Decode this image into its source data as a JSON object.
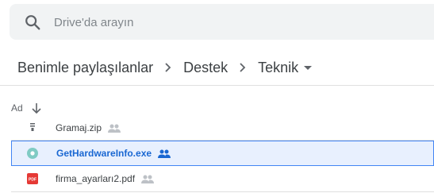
{
  "search": {
    "placeholder": "Drive'da arayın",
    "icon": "search-icon"
  },
  "breadcrumb": {
    "items": [
      "Benimle paylaşılanlar",
      "Destek",
      "Teknik"
    ]
  },
  "table": {
    "name_header": "Ad",
    "sort": "ascending",
    "rows": [
      {
        "name": "Gramaj.zip",
        "type": "zip",
        "shared": true,
        "selected": false
      },
      {
        "name": "GetHardwareInfo.exe",
        "type": "exe",
        "shared": true,
        "selected": true
      },
      {
        "name": "firma_ayarları2.pdf",
        "type": "pdf",
        "shared": true,
        "selected": false
      }
    ]
  },
  "colors": {
    "accent": "#1967d2",
    "selection_bg": "#e8f0fe",
    "pdf_red": "#e53935",
    "exe_teal": "#80cbc4"
  }
}
